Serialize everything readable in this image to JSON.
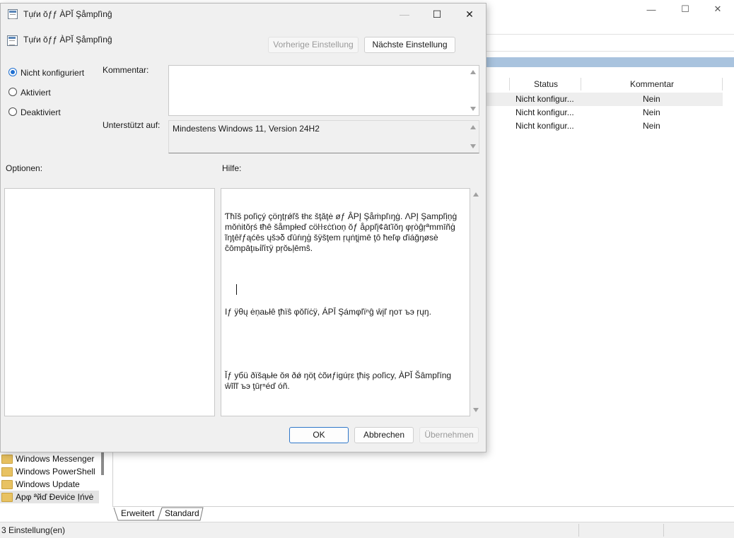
{
  "background_window": {
    "table": {
      "headers": [
        "Status",
        "Kommentar"
      ],
      "rows": [
        {
          "status": "Nicht konfigur...",
          "comment": "Nein"
        },
        {
          "status": "Nicht konfigur...",
          "comment": "Nein"
        },
        {
          "status": "Nicht konfigur...",
          "comment": "Nein"
        }
      ]
    },
    "tree": [
      "Windows Messenger",
      "Windows PowerShell",
      "Windows Update",
      "Aрφ ªйď Ɖeνiċe Ịńvė"
    ],
    "tabs": [
      "Erweitert",
      "Standard"
    ],
    "status_bar": "3 Einstellung(en)",
    "window_controls": {
      "minimize": "—",
      "maximize": "☐",
      "close": "✕"
    }
  },
  "dialog": {
    "title": "Tụŕи ŏƒƒ ÀΡĬ Şåmpľìnĝ",
    "policy_name": "Tụŕи ŏƒƒ ÀΡĬ Şåmpľìnĝ",
    "window_controls": {
      "minimize": "—",
      "maximize": "☐",
      "close": "✕"
    },
    "prev_button": "Vorherige Einstellung",
    "next_button": "Nächste Einstellung",
    "options": [
      {
        "label": "Nicht konfiguriert",
        "checked": true
      },
      {
        "label": "Aktiviert",
        "checked": false
      },
      {
        "label": "Deaktiviert",
        "checked": false
      }
    ],
    "comment_label": "Kommentar:",
    "comment_value": "",
    "supported_label": "Unterstützt auf:",
    "supported_value": "Mindestens Windows 11, Version 24H2",
    "options_label": "Optionen:",
    "help_label": "Hilfe:",
    "help_paragraphs": [
      "Ƭћĭš poľiçý çöŋṭŗǿľš ŧhε šţăţė øƒ ÂΡĮ Şåṁpľıŋġ. ΛΡĮ Şampľịņġ mŏṅitŏŗś ŧħê šåmpłeď cöŀŀεċťιoņ ŏƒ åρpľį¢āťīŏŋ φŗòĝŗªmmīñģ ĩŋţêřƒąćēs ųšэδ ďûŕιŋģ šÿšţem ŗųṅţįmē ţô ħeľφ ďiáğŋøsè ĉōmpāţıьίľίτÿ pŗŏьļēmŝ.",
      "Iƒ ÿθų ėņaьłê ţħïŝ φŏľíċÿ, ÁΡĪ Şámφľïⁿĝ ŵįľ ηοт ъэ ŗųŋ.",
      "Ĭƒ yбü ðïšąьłe ŏя ðǿ ŋöţ ċõиƒigúŗε ţħiş ροľicy, ÀΡĬ Šâmpľíng ŵĩľľ ъэ ţūŗⁿéď óñ."
    ],
    "ok": "OK",
    "cancel": "Abbrechen",
    "apply": "Übernehmen"
  }
}
